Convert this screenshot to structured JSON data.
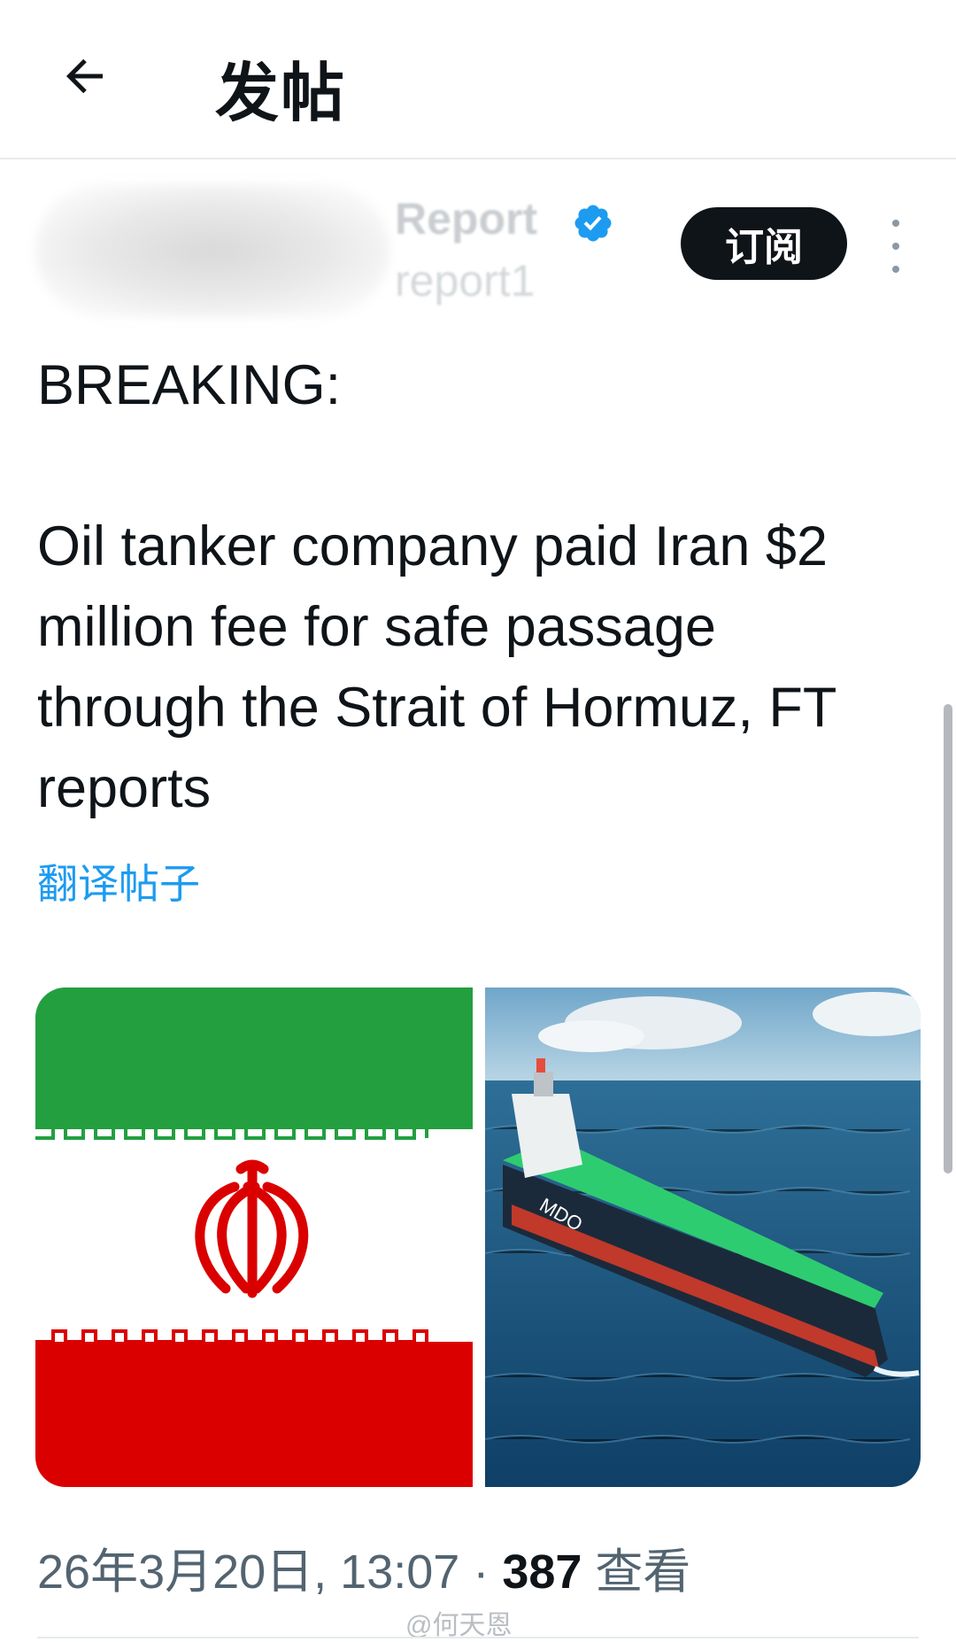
{
  "header": {
    "title": "发帖",
    "back_icon": "arrow-left-icon"
  },
  "author": {
    "display_name": "Report",
    "handle": "report1",
    "verified_icon": "verified-badge-icon",
    "verified_color": "#1d9bf0",
    "subscribe_label": "订阅",
    "more_icon": "more-vertical-icon"
  },
  "post": {
    "line1": "BREAKING:",
    "line2": "Oil tanker company paid Iran $2 million fee for safe passage through the Strait of Hormuz, FT reports",
    "translate_label": "翻译帖子"
  },
  "media": {
    "images": [
      {
        "name": "iran-flag",
        "colors": [
          "#239f40",
          "#ffffff",
          "#da0000"
        ]
      },
      {
        "name": "oil-tanker-ship",
        "hull_text": "MDO"
      }
    ]
  },
  "meta": {
    "timestamp": "26年3月20日, 13:07",
    "separator": " · ",
    "views_count": "387",
    "views_label": " 查看"
  },
  "watermark": "@何天恩",
  "colors": {
    "accent": "#1d9bf0",
    "text": "#0f1419",
    "secondary": "#536471"
  }
}
